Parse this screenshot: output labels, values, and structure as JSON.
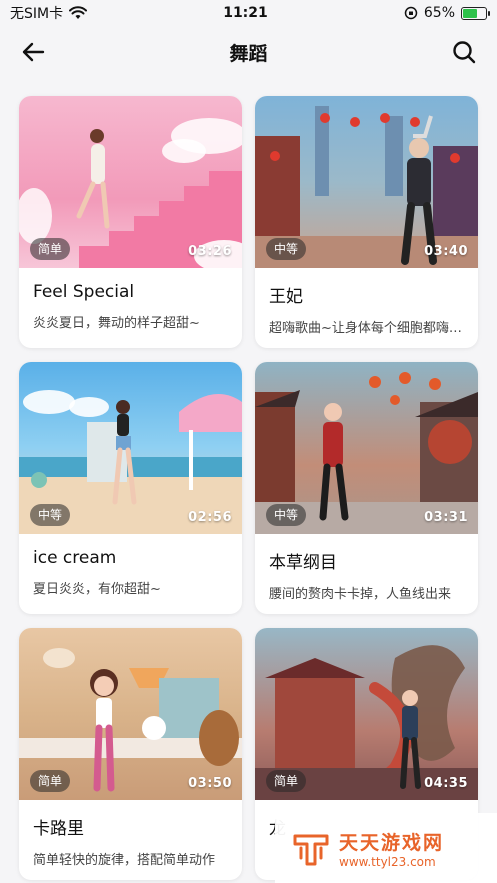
{
  "status": {
    "carrier": "无SIM卡",
    "time": "11:21",
    "battery": "65%",
    "battery_level": 0.65,
    "battery_color": "#2cc24a"
  },
  "header": {
    "title": "舞蹈",
    "back_icon": "arrow-left-icon",
    "search_icon": "search-icon"
  },
  "cards": [
    {
      "title": "Feel Special",
      "desc": "炎炎夏日，舞动的样子超甜~",
      "level": "简单",
      "duration": "03:26"
    },
    {
      "title": "王妃",
      "desc": "超嗨歌曲~让身体每个细胞都嗨起来",
      "level": "中等",
      "duration": "03:40"
    },
    {
      "title": "ice cream",
      "desc": "夏日炎炎，有你超甜~",
      "level": "中等",
      "duration": "02:56"
    },
    {
      "title": "本草纲目",
      "desc": "腰间的赘肉卡卡掉，人鱼线出来",
      "level": "中等",
      "duration": "03:31"
    },
    {
      "title": "卡路里",
      "desc": "简单轻快的旋律，搭配简单动作",
      "level": "简单",
      "duration": "03:50"
    },
    {
      "title": "龙",
      "desc": "",
      "level": "简单",
      "duration": "04:35"
    }
  ],
  "watermark": {
    "title": "天天游戏网",
    "url": "www.ttyl23.com"
  }
}
